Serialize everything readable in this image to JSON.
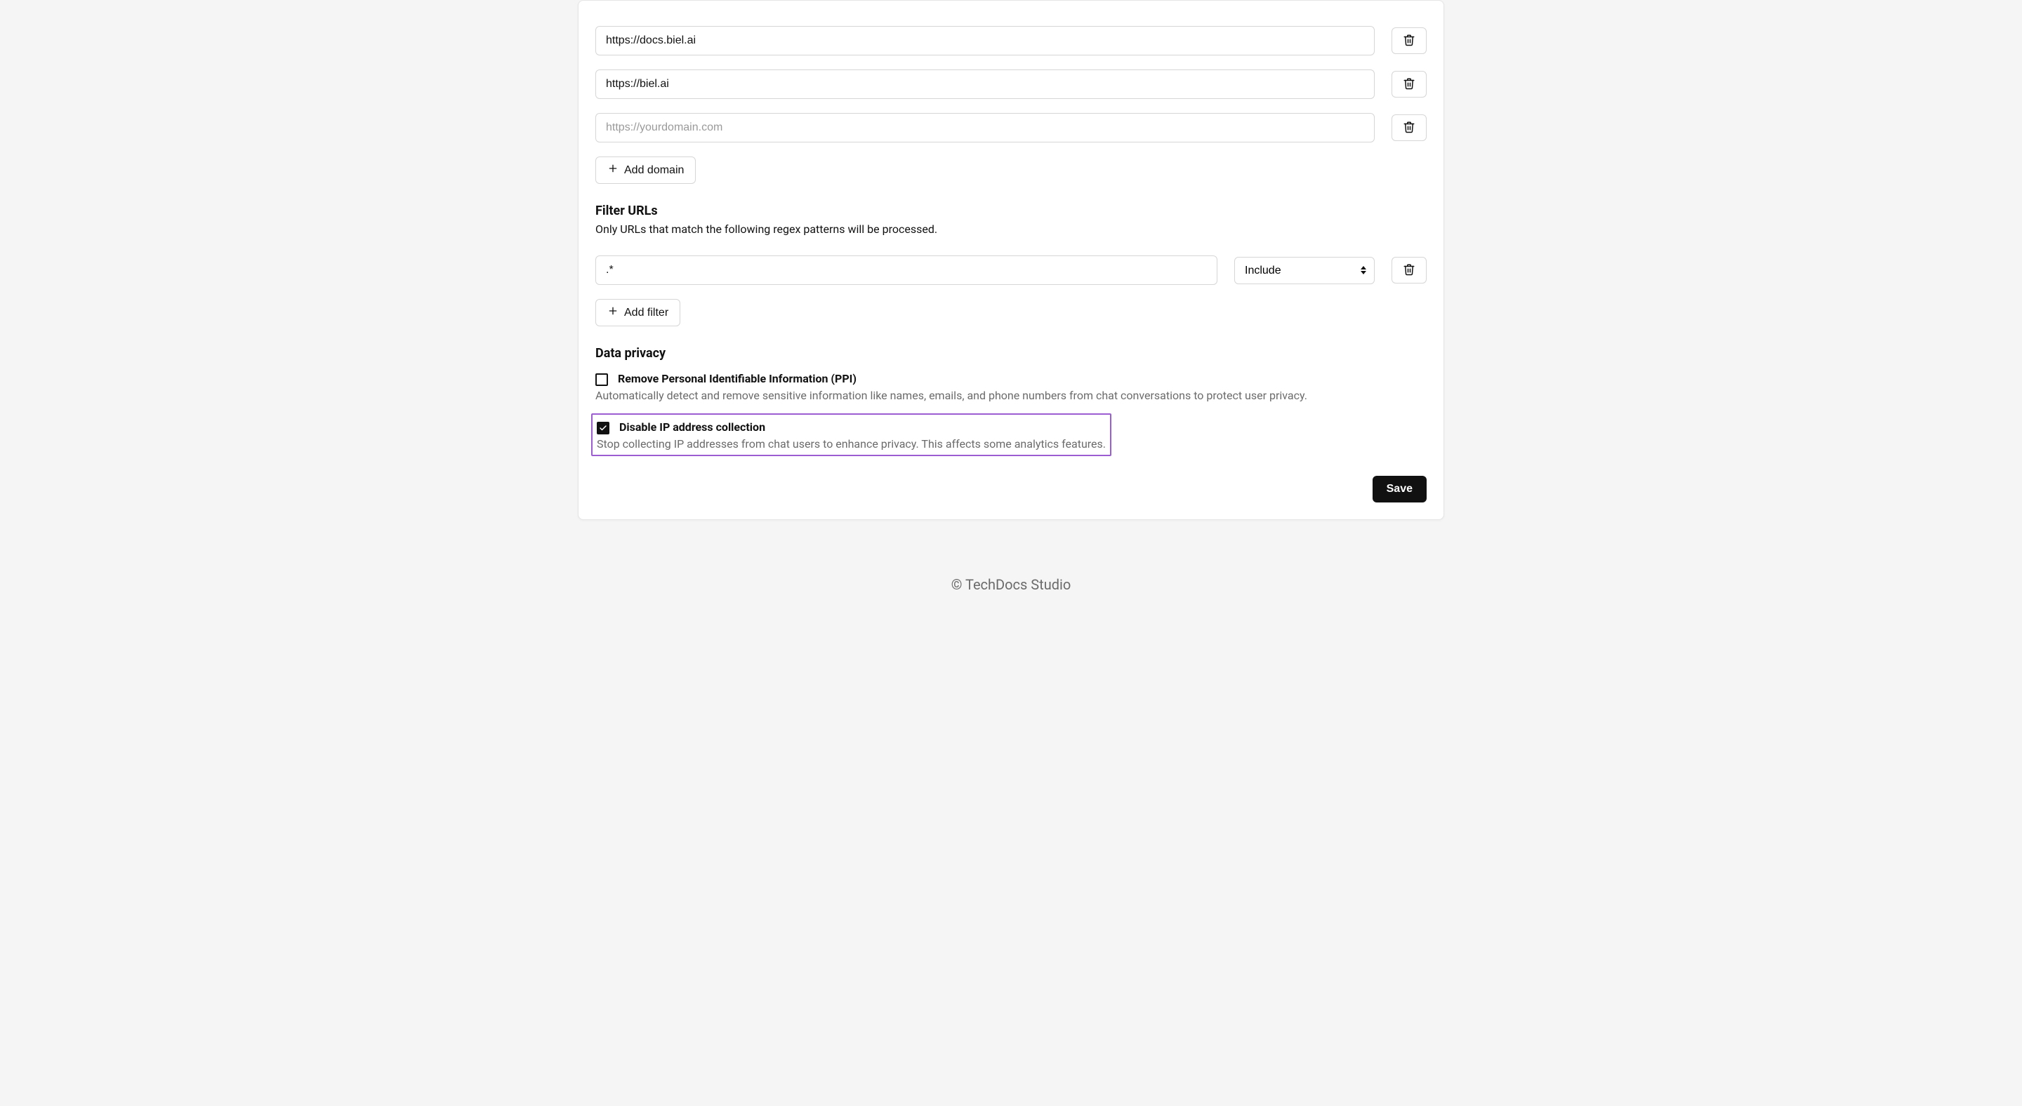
{
  "domains": {
    "items": [
      {
        "value": "https://docs.biel.ai"
      },
      {
        "value": "https://biel.ai"
      },
      {
        "value": "",
        "placeholder": "https://yourdomain.com"
      }
    ],
    "add_label": "Add domain"
  },
  "filter_urls": {
    "title": "Filter URLs",
    "desc": "Only URLs that match the following regex patterns will be processed.",
    "items": [
      {
        "pattern": ".*",
        "mode": "Include"
      }
    ],
    "add_label": "Add filter"
  },
  "data_privacy": {
    "title": "Data privacy",
    "ppi": {
      "checked": false,
      "label": "Remove Personal Identifiable Information (PPI)",
      "desc": "Automatically detect and remove sensitive information like names, emails, and phone numbers from chat conversations to protect user privacy."
    },
    "ip": {
      "checked": true,
      "label": "Disable IP address collection",
      "desc": "Stop collecting IP addresses from chat users to enhance privacy. This affects some analytics features."
    }
  },
  "save_label": "Save",
  "footer": "© TechDocs Studio"
}
